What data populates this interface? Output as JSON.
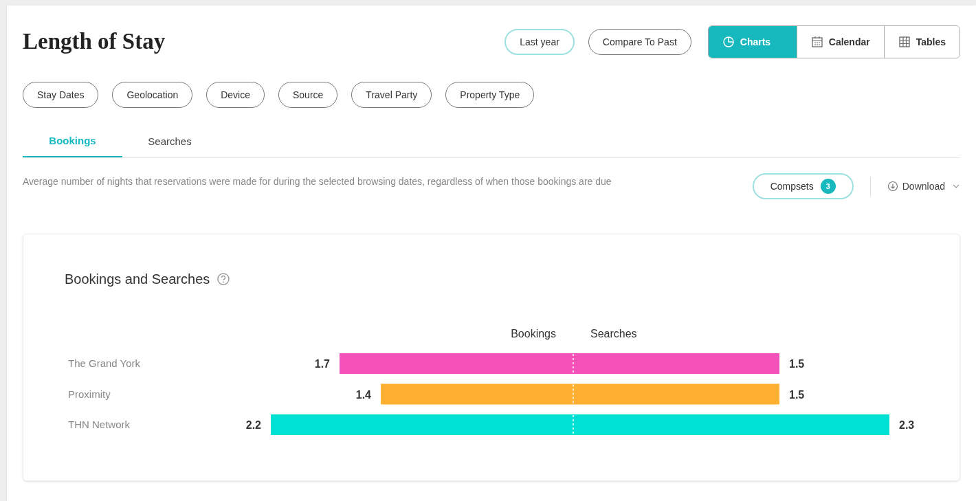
{
  "title": "Length of Stay",
  "header_buttons": [
    {
      "label": "Last year",
      "selected": true
    },
    {
      "label": "Compare To Past",
      "selected": false
    }
  ],
  "view_switch": [
    {
      "label": "Charts",
      "selected": true
    },
    {
      "label": "Calendar",
      "selected": false
    },
    {
      "label": "Tables",
      "selected": false
    }
  ],
  "filters": [
    "Stay Dates",
    "Geolocation",
    "Device",
    "Source",
    "Travel Party",
    "Property Type"
  ],
  "tabs": [
    {
      "label": "Bookings",
      "selected": true
    },
    {
      "label": "Searches",
      "selected": false
    }
  ],
  "description": "Average number of nights that reservations were made for during the selected browsing dates, regardless of when those bookings are due",
  "compsets": {
    "label": "Compsets",
    "count": "3"
  },
  "download": {
    "label": "Download"
  },
  "chart_card": {
    "title": "Bookings and Searches",
    "left_heading": "Bookings",
    "right_heading": "Searches",
    "rows": [
      {
        "label": "The Grand York",
        "bookings": "1.7",
        "searches": "1.5",
        "color": "#f552b9"
      },
      {
        "label": "Proximity",
        "bookings": "1.4",
        "searches": "1.5",
        "color": "#ffb030"
      },
      {
        "label": "THN Network",
        "bookings": "2.2",
        "searches": "2.3",
        "color": "#00e1d6"
      }
    ]
  }
}
